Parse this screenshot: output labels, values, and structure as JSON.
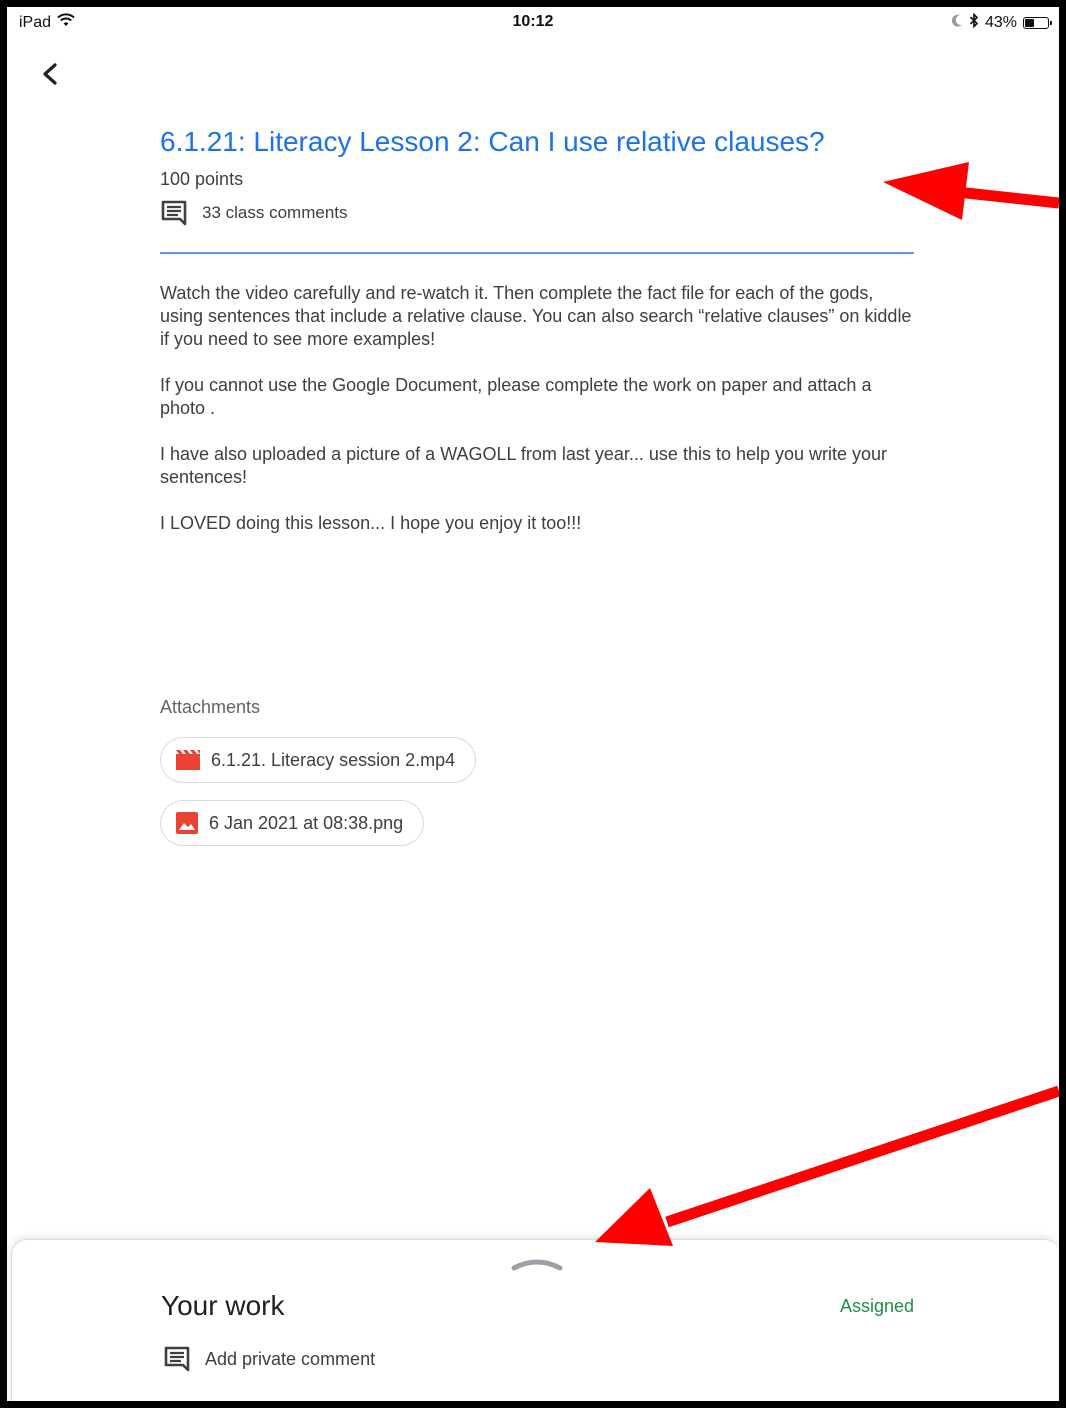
{
  "status_bar": {
    "device": "iPad",
    "time": "10:12",
    "battery": "43%",
    "battery_level": 0.43,
    "icons": [
      "wifi-icon",
      "moon-icon",
      "bluetooth-icon",
      "battery-icon"
    ]
  },
  "nav": {
    "back_icon": "chevron-left-icon"
  },
  "assignment": {
    "title": "6.1.21: Literacy Lesson 2: Can I use relative clauses?",
    "points": "100 points",
    "comments_label": "33 class comments",
    "description": [
      "Watch the video carefully and re-watch it. Then complete the fact file for each of the gods, using sentences that include a relative clause. You can also search “relative clauses” on kiddle if you need to see more examples!",
      "If you cannot use the Google Document, please complete the work on paper and attach a photo .",
      "I have also uploaded a picture of a  WAGOLL from last year... use this to help you write your sentences!",
      "I LOVED doing this lesson... I hope you enjoy it too!!!"
    ]
  },
  "attachments": {
    "label": "Attachments",
    "items": [
      {
        "name": "6.1.21. Literacy session 2.mp4",
        "icon": "video-file-icon"
      },
      {
        "name": "6 Jan 2021 at 08:38.png",
        "icon": "image-file-icon"
      }
    ]
  },
  "your_work": {
    "title": "Your work",
    "status": "Assigned",
    "private_comment": "Add private comment"
  },
  "colors": {
    "title": "#1a73e8",
    "assigned": "#1e8e3e",
    "attachment_icon": "#ea4335",
    "annotation_arrow": "#ff0000"
  }
}
